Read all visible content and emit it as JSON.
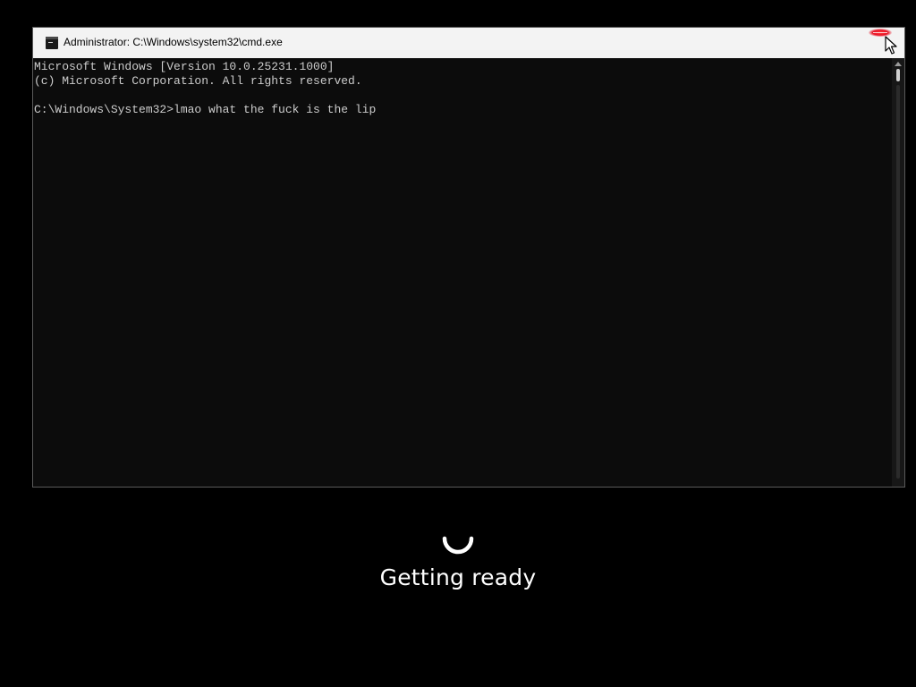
{
  "window": {
    "title": "Administrator: C:\\Windows\\system32\\cmd.exe",
    "icon": "cmd-icon",
    "close_icon": "close-icon"
  },
  "console": {
    "lines": [
      "Microsoft Windows [Version 10.0.25231.1000]",
      "(c) Microsoft Corporation. All rights reserved.",
      "",
      "C:\\Windows\\System32>lmao what the fuck is the lip"
    ],
    "text_color": "#cccccc",
    "background": "#0c0c0c"
  },
  "overlay": {
    "status": "Getting ready",
    "spinner_icon": "loading-spinner-icon"
  },
  "colors": {
    "close_hover": "#e81123",
    "title_bar": "#f3f3f3"
  }
}
